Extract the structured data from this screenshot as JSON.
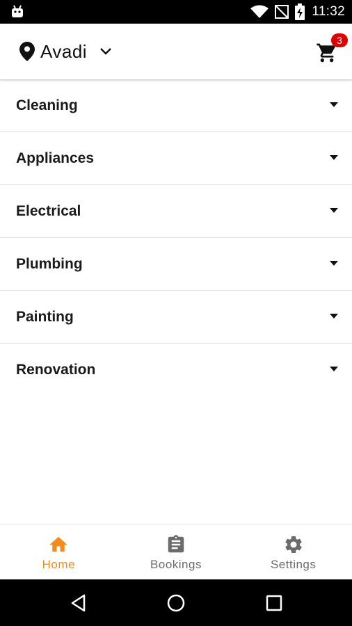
{
  "status_bar": {
    "time": "11:32"
  },
  "header": {
    "location": "Avadi",
    "cart_count": "3"
  },
  "categories": [
    {
      "label": "Cleaning"
    },
    {
      "label": "Appliances"
    },
    {
      "label": "Electrical"
    },
    {
      "label": "Plumbing"
    },
    {
      "label": "Painting"
    },
    {
      "label": "Renovation"
    }
  ],
  "bottom_nav": {
    "home": "Home",
    "bookings": "Bookings",
    "settings": "Settings",
    "active": "home"
  },
  "colors": {
    "accent": "#f28c1e",
    "badge": "#e00000",
    "inactive": "#6b6b6b"
  }
}
